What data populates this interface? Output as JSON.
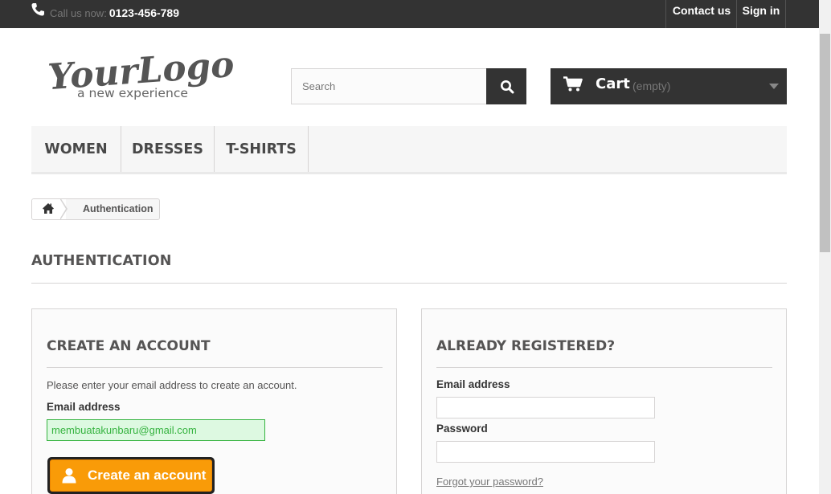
{
  "topbar": {
    "call_label": "Call us now:",
    "phone": "0123-456-789",
    "contact_label": "Contact us",
    "signin_label": "Sign in"
  },
  "header": {
    "logo_main": "YourLogo",
    "logo_tagline": "a new experience",
    "search_placeholder": "Search",
    "cart_label": "Cart",
    "cart_status": "(empty)"
  },
  "menu": {
    "items": [
      {
        "label": "WOMEN"
      },
      {
        "label": "DRESSES"
      },
      {
        "label": "T-SHIRTS"
      }
    ]
  },
  "breadcrumb": {
    "current": "Authentication"
  },
  "page": {
    "heading": "AUTHENTICATION"
  },
  "create_account": {
    "title": "CREATE AN ACCOUNT",
    "intro": "Please enter your email address to create an account.",
    "email_label": "Email address",
    "email_value": "membuatakunbaru@gmail.com",
    "button_label": "Create an account"
  },
  "login": {
    "title": "ALREADY REGISTERED?",
    "email_label": "Email address",
    "email_value": "",
    "password_label": "Password",
    "password_value": "",
    "forgot_label": "Forgot your password?"
  },
  "colors": {
    "dark": "#333333",
    "accent_orange": "#f99b08",
    "valid_green": "#35b33f",
    "valid_bg": "#ddf9e1"
  },
  "icons": {
    "phone": "phone-icon",
    "search": "search-icon",
    "cart": "cart-icon",
    "caret": "caret-down-icon",
    "home": "home-icon",
    "user": "user-icon"
  }
}
